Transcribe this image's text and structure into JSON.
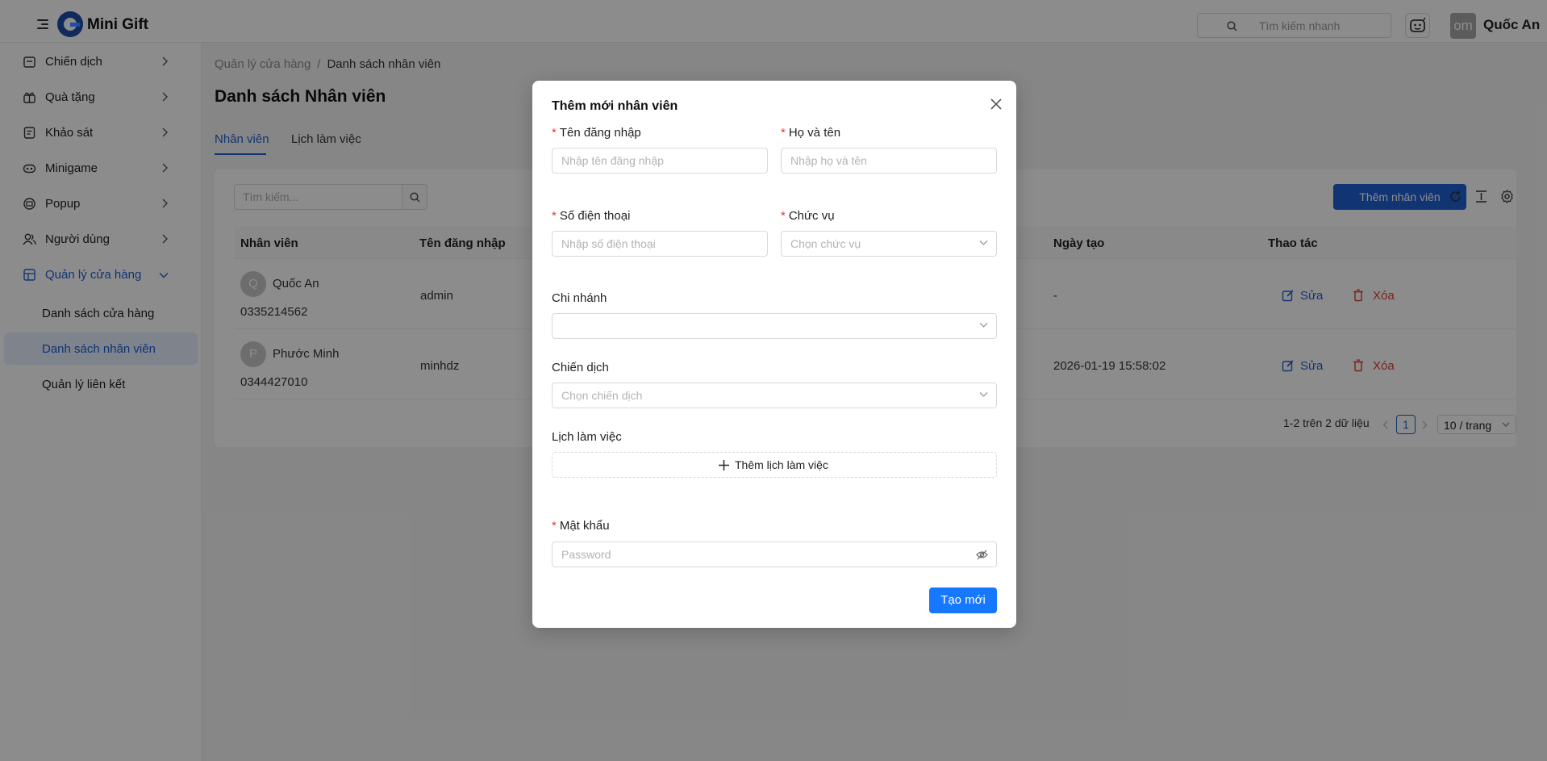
{
  "header": {
    "brand": "Mini Gift",
    "search_placeholder": "Tìm kiếm nhanh",
    "user_initials": "om",
    "user_name": "Quốc An"
  },
  "sidebar": {
    "items": [
      {
        "label": "Chiến dịch",
        "icon": "campaign-icon"
      },
      {
        "label": "Quà tặng",
        "icon": "gift-icon"
      },
      {
        "label": "Khảo sát",
        "icon": "survey-icon"
      },
      {
        "label": "Minigame",
        "icon": "gamepad-icon"
      },
      {
        "label": "Popup",
        "icon": "popup-icon"
      },
      {
        "label": "Người dùng",
        "icon": "users-icon"
      },
      {
        "label": "Quản lý cửa hàng",
        "icon": "store-icon"
      }
    ],
    "subitems": [
      {
        "label": "Danh sách cửa hàng"
      },
      {
        "label": "Danh sách nhân viên"
      },
      {
        "label": "Quản lý liên kết"
      }
    ]
  },
  "main": {
    "breadcrumb": [
      "Quản lý cửa hàng",
      "/",
      "Danh sách nhân viên"
    ],
    "title": "Danh sách Nhân viên",
    "tabs": [
      {
        "label": "Nhân viên"
      },
      {
        "label": "Lịch làm việc"
      }
    ],
    "search_placeholder": "Tìm kiếm...",
    "add_button": "Thêm nhân viên",
    "columns": [
      "Nhân viên",
      "Tên đăng nhập",
      "Ngày tạo",
      "Thao tác"
    ],
    "rows": [
      {
        "initial": "Q",
        "name": "Quốc An",
        "phone": "0335214562",
        "username": "admin",
        "created": "-"
      },
      {
        "initial": "P",
        "name": "Phước Minh",
        "phone": "0344427010",
        "username": "minhdz",
        "created": "2026-01-19 15:58:02"
      }
    ],
    "actions": {
      "edit": "Sửa",
      "delete": "Xóa"
    },
    "pagination": {
      "summary": "1-2 trên 2 dữ liệu",
      "page": "1",
      "size": "10 / trang"
    }
  },
  "modal": {
    "title": "Thêm mới nhân viên",
    "fields": {
      "username": {
        "label": "Tên đăng nhập",
        "placeholder": "Nhập tên đăng nhập"
      },
      "fullname": {
        "label": "Họ và tên",
        "placeholder": "Nhập họ và tên"
      },
      "phone": {
        "label": "Số điện thoại",
        "placeholder": "Nhập số điện thoại"
      },
      "position": {
        "label": "Chức vụ",
        "placeholder": "Chọn chức vụ"
      },
      "branch": {
        "label": "Chi nhánh",
        "placeholder": ""
      },
      "campaign": {
        "label": "Chiến dịch",
        "placeholder": "Chọn chiến dịch"
      },
      "schedule": {
        "label": "Lịch làm việc",
        "button": "Thêm lịch làm việc"
      },
      "password": {
        "label": "Mật khẩu",
        "placeholder": "Password"
      }
    },
    "submit": "Tạo mới"
  },
  "colors": {
    "primary": "#1f5fd1",
    "submit": "#1677ff",
    "danger": "#e03c31"
  }
}
